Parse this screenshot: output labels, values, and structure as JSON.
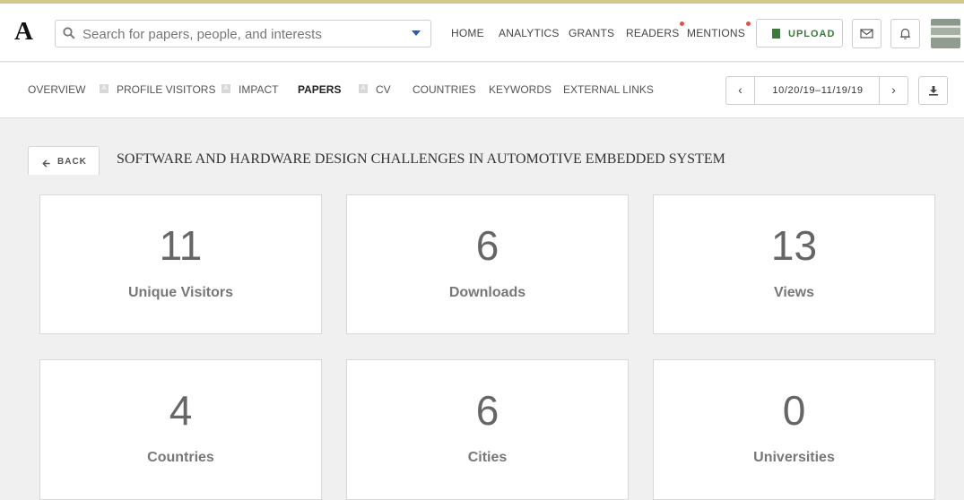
{
  "header": {
    "logo": "A",
    "search_placeholder": "Search for papers, people, and interests",
    "nav": [
      {
        "label": "HOME"
      },
      {
        "label": "ANALYTICS"
      },
      {
        "label": "GRANTS"
      },
      {
        "label": "READERS"
      },
      {
        "label": "MENTIONS"
      }
    ],
    "upload_label": "UPLOAD"
  },
  "tabs": [
    {
      "label": "OVERVIEW"
    },
    {
      "label": "PROFILE VISITORS"
    },
    {
      "label": "IMPACT"
    },
    {
      "label": "PAPERS"
    },
    {
      "label": "CV"
    },
    {
      "label": "COUNTRIES"
    },
    {
      "label": "KEYWORDS"
    },
    {
      "label": "EXTERNAL LINKS"
    }
  ],
  "locked_tab_icon": "A",
  "date_range": "10/20/19–11/19/19",
  "back_label": "BACK",
  "paper_title": "SOFTWARE AND HARDWARE DESIGN CHALLENGES IN AUTOMOTIVE EMBEDDED SYSTEM",
  "stats": [
    {
      "value": "11",
      "label": "Unique Visitors"
    },
    {
      "value": "6",
      "label": "Downloads"
    },
    {
      "value": "13",
      "label": "Views"
    },
    {
      "value": "4",
      "label": "Countries"
    },
    {
      "value": "6",
      "label": "Cities"
    },
    {
      "value": "0",
      "label": "Universities"
    }
  ],
  "colors": {
    "top_stripe": "#cfc98a",
    "upload_green": "#3a7a3a",
    "notification_dot": "#d9534f",
    "search_caret": "#2e5aa8"
  }
}
